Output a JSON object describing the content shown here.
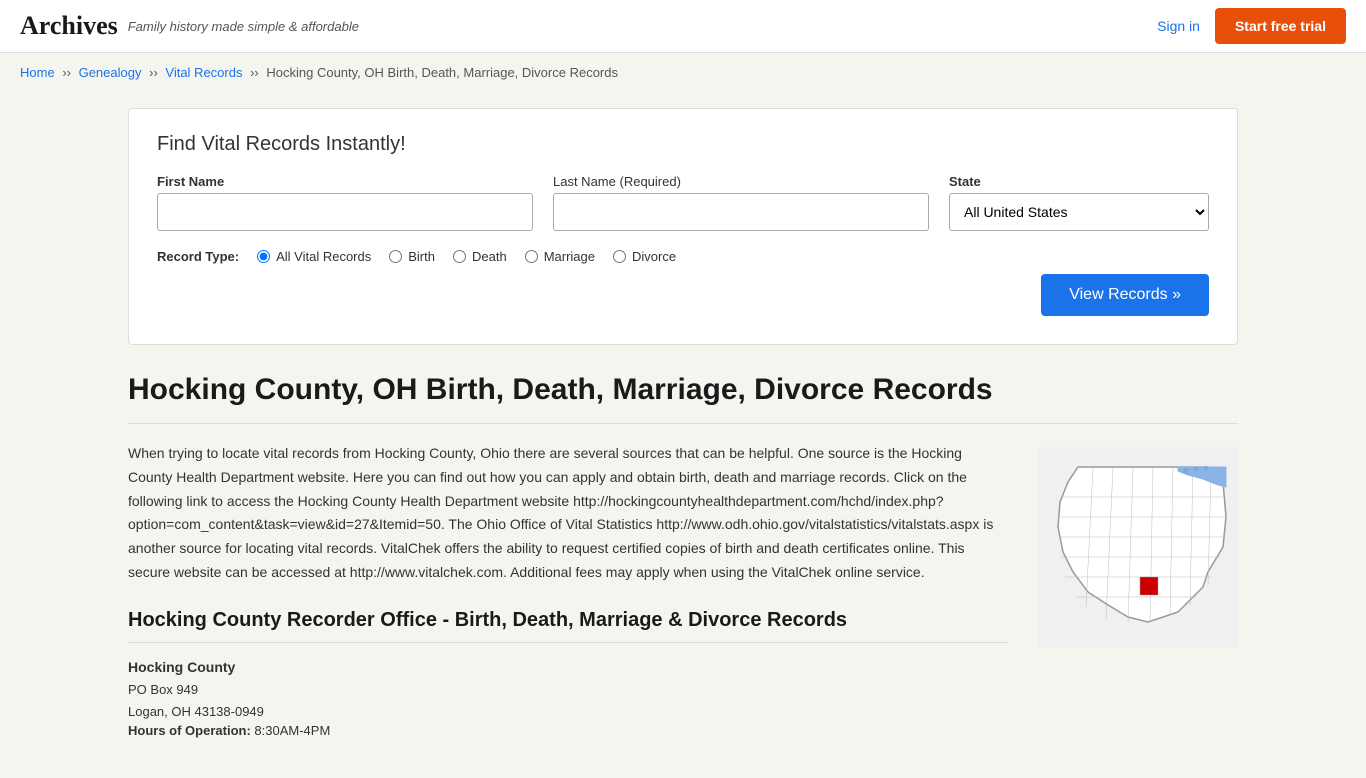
{
  "header": {
    "logo": "Archives",
    "tagline": "Family history made simple & affordable",
    "sign_in": "Sign in",
    "start_trial": "Start free trial"
  },
  "breadcrumb": {
    "items": [
      {
        "label": "Home",
        "href": "#"
      },
      {
        "label": "Genealogy",
        "href": "#"
      },
      {
        "label": "Vital Records",
        "href": "#"
      },
      {
        "label": "Hocking County, OH Birth, Death, Marriage, Divorce Records",
        "href": "#"
      }
    ]
  },
  "search": {
    "title": "Find Vital Records Instantly!",
    "first_name_label": "First Name",
    "last_name_label": "Last Name",
    "last_name_required": "(Required)",
    "state_label": "State",
    "state_default": "All United States",
    "record_type_label": "Record Type:",
    "record_types": [
      {
        "label": "All Vital Records",
        "value": "all",
        "checked": true
      },
      {
        "label": "Birth",
        "value": "birth"
      },
      {
        "label": "Death",
        "value": "death"
      },
      {
        "label": "Marriage",
        "value": "marriage"
      },
      {
        "label": "Divorce",
        "value": "divorce"
      }
    ],
    "view_button": "View Records »"
  },
  "page": {
    "title": "Hocking County, OH Birth, Death, Marriage, Divorce Records",
    "description": "When trying to locate vital records from Hocking County, Ohio there are several sources that can be helpful. One source is the Hocking County Health Department website. Here you can find out how you can apply and obtain birth, death and marriage records. Click on the following link to access the Hocking County Health Department website http://hockingcountyhealthdepartment.com/hchd/index.php?option=com_content&task=view&id=27&Itemid=50. The Ohio Office of Vital Statistics http://www.odh.ohio.gov/vitalstatistics/vitalstats.aspx is another source for locating vital records. VitalChek offers the ability to request certified copies of birth and death certificates online. This secure website can be accessed at http://www.vitalchek.com. Additional fees may apply when using the VitalChek online service.",
    "section_title": "Hocking County Recorder Office - Birth, Death, Marriage & Divorce Records",
    "office": {
      "name": "Hocking County",
      "address_line1": "PO Box 949",
      "address_line2": "Logan, OH 43138-0949",
      "hours_label": "Hours of Operation:",
      "hours_value": "8:30AM-4PM"
    }
  }
}
